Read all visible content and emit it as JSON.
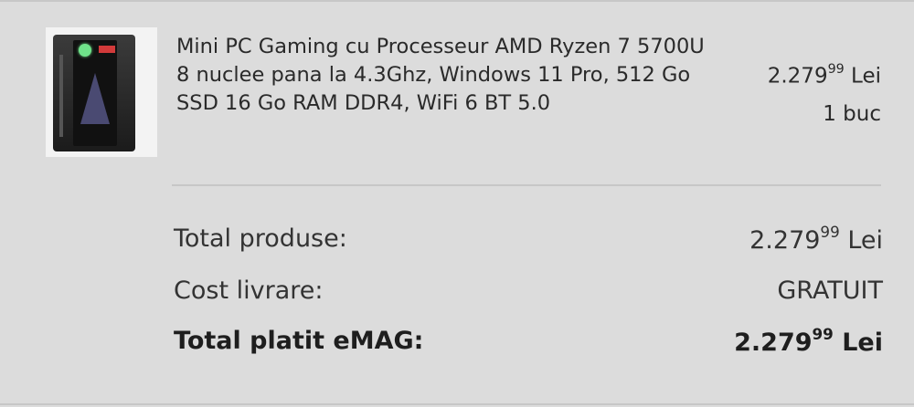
{
  "product": {
    "title": "Mini PC Gaming cu Processeur AMD Ryzen 7 5700U 8 nuclee pana la 4.3Ghz, Windows 11 Pro, 512 Go SSD 16 Go RAM DDR4, WiFi 6 BT 5.0",
    "price_main": "2.279",
    "price_cents": "99",
    "currency": "Lei",
    "quantity": "1 buc",
    "image_icon": "mini-pc-image"
  },
  "summary": {
    "total_products_label": "Total produse:",
    "total_products_main": "2.279",
    "total_products_cents": "99",
    "total_products_currency": "Lei",
    "delivery_label": "Cost livrare:",
    "delivery_value": "GRATUIT",
    "total_paid_label": "Total platit eMAG:",
    "total_paid_main": "2.279",
    "total_paid_cents": "99",
    "total_paid_currency": "Lei"
  },
  "colors": {
    "background": "#dcdcdc",
    "text": "#2a2a2a",
    "divider": "#c7c7c7"
  }
}
